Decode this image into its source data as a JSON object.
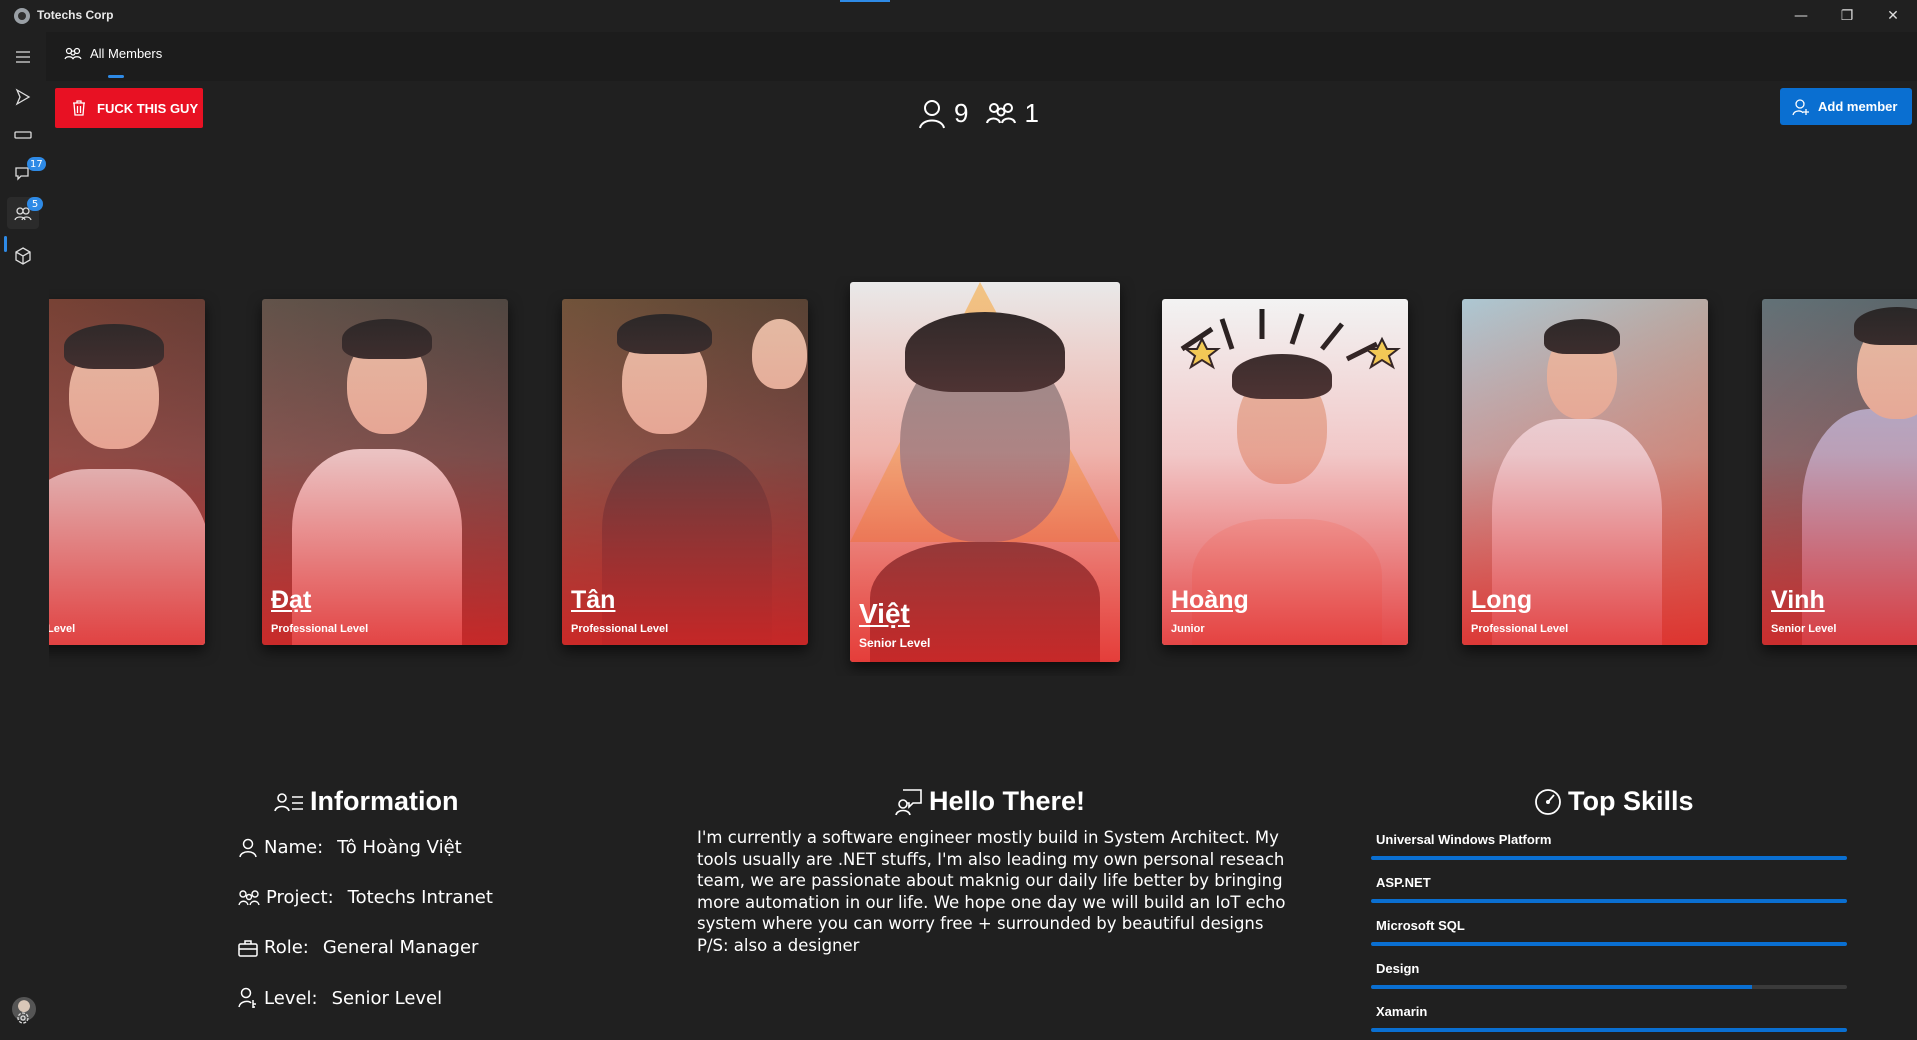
{
  "window": {
    "title": "Totechs Corp",
    "controls": [
      "—",
      "❐",
      "✕"
    ]
  },
  "nav": {
    "items": [
      {
        "name": "menu",
        "badge": null
      },
      {
        "name": "projects",
        "badge": null
      },
      {
        "name": "devices",
        "badge": null
      },
      {
        "name": "chat",
        "badge": "17"
      },
      {
        "name": "members",
        "badge": "5"
      },
      {
        "name": "packages",
        "badge": null
      }
    ]
  },
  "tab": {
    "label": "All Members"
  },
  "actions": {
    "delete_label": "FUCK THIS GUY",
    "add_label": "Add member"
  },
  "counts": {
    "members": "9",
    "groups": "1"
  },
  "members": [
    {
      "name": "",
      "level": "Level"
    },
    {
      "name": "Đạt",
      "level": "Professional Level"
    },
    {
      "name": "Tân",
      "level": "Professional Level"
    },
    {
      "name": "Việt",
      "level": "Senior Level"
    },
    {
      "name": "Hoàng",
      "level": "Junior"
    },
    {
      "name": "Long",
      "level": "Professional Level"
    },
    {
      "name": "Vinh",
      "level": "Senior Level"
    }
  ],
  "information": {
    "title": "Information",
    "rows": [
      {
        "label": "Name:",
        "value": "Tô Hoàng Việt"
      },
      {
        "label": "Project:",
        "value": "Totechs Intranet"
      },
      {
        "label": "Role:",
        "value": "General Manager"
      },
      {
        "label": "Level:",
        "value": "Senior Level"
      }
    ]
  },
  "hello": {
    "title": "Hello There!",
    "lines": [
      "I'm currently a software engineer mostly build in System Architect. My",
      "tools usually are .NET stuffs, I'm also leading my own personal reseach",
      "team, we are passionate about maknig our daily life better by bringing",
      "more automation in our life. We hope one day we will build an IoT echo",
      "system where you can worry free + surrounded by beautiful designs",
      "P/S: also a designer"
    ]
  },
  "skills": {
    "title": "Top Skills",
    "items": [
      {
        "name": "Universal Windows Platform",
        "level": 1.0
      },
      {
        "name": "ASP.NET",
        "level": 1.0
      },
      {
        "name": "Microsoft SQL",
        "level": 1.0
      },
      {
        "name": "Design",
        "level": 0.8
      },
      {
        "name": "Xamarin",
        "level": 1.0
      }
    ]
  },
  "colors": {
    "accent": "#0a6fd1",
    "danger": "#e81123",
    "background": "#202020"
  }
}
